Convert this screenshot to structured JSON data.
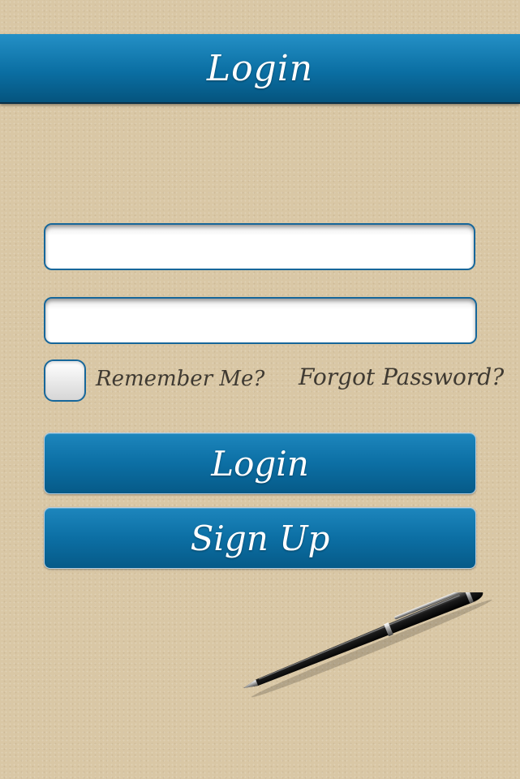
{
  "header": {
    "title": "Login"
  },
  "form": {
    "username": {
      "value": "",
      "placeholder": ""
    },
    "password": {
      "value": "",
      "placeholder": ""
    },
    "remember_label": "Remember Me?",
    "remember_checked": false,
    "forgot_label": "Forgot Password?",
    "login_label": "Login",
    "signup_label": "Sign Up"
  },
  "colors": {
    "background": "#d9c7a5",
    "accent": "#0b6fa3",
    "handwriting": "#3f3a32"
  },
  "decor": {
    "icon": "pen-icon"
  }
}
